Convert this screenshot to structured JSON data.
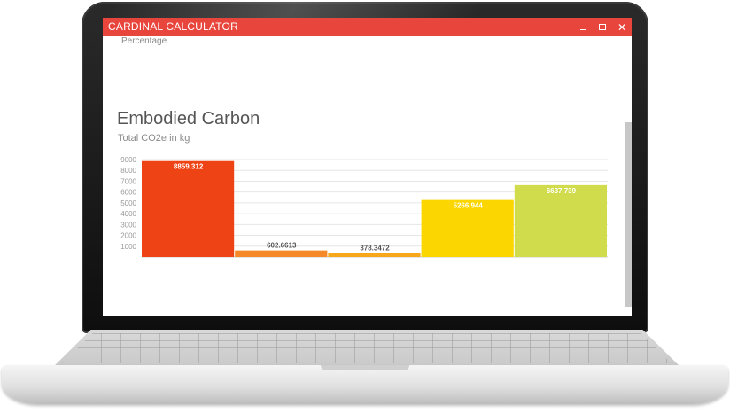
{
  "window": {
    "title": "CARDINAL CALCULATOR",
    "minimize_icon": "minimize-icon",
    "maximize_icon": "maximize-icon",
    "close_icon": "close-icon",
    "close_glyph": "✕"
  },
  "content": {
    "partial_label": "Percentage"
  },
  "chart_data": {
    "type": "bar",
    "title": "Embodied Carbon",
    "subtitle": "Total CO2e in kg",
    "categories": [
      "",
      "",
      "",
      "",
      ""
    ],
    "values": [
      8859.312,
      602.6613,
      378.3472,
      5266.944,
      6637.739
    ],
    "value_labels": [
      "8859.312",
      "602.6613",
      "378.3472",
      "5266.944",
      "6637.739"
    ],
    "colors": [
      "#ee4415",
      "#f5892a",
      "#f6a71a",
      "#fbd600",
      "#d0dc4c"
    ],
    "label_colors": [
      "#ffffff",
      "#555555",
      "#555555",
      "#ffffff",
      "#ffffff"
    ],
    "yticks": [
      1000,
      2000,
      3000,
      4000,
      5000,
      6000,
      7000,
      8000,
      9000
    ],
    "ylim": [
      0,
      9000
    ],
    "grid": true,
    "legend": "none"
  }
}
